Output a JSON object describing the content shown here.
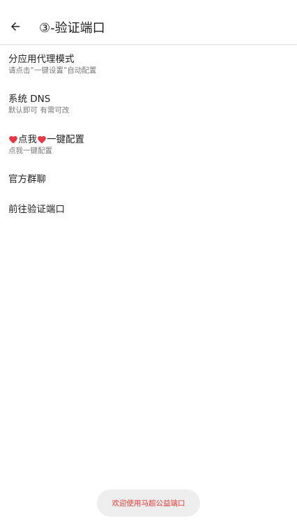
{
  "header": {
    "title": "③-验证端口"
  },
  "items": [
    {
      "title": "分应用代理模式",
      "subtitle": "请点击“一键设置”自动配置"
    },
    {
      "title": "系统 DNS",
      "subtitle": "默认即可 有需可改"
    },
    {
      "title_text_1": "点我",
      "title_text_2": "一键配置",
      "subtitle": "点我一键配置"
    },
    {
      "title": "官方群聊"
    },
    {
      "title": "前往验证端口"
    }
  ],
  "toast": {
    "text": "欢迎使用马超公益端口",
    "color": "#e53935"
  },
  "colors": {
    "heart": "#e53945"
  }
}
